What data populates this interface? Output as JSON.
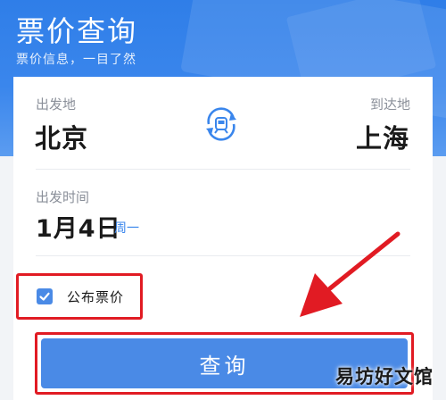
{
  "header": {
    "title": "票价查询",
    "subtitle": "票价信息，一目了然"
  },
  "route": {
    "from_label": "出发地",
    "from_city": "北京",
    "to_label": "到达地",
    "to_city": "上海",
    "swap_icon": "train-swap-icon"
  },
  "departure": {
    "label": "出发时间",
    "date": "1月4日",
    "weekday": "周一"
  },
  "options": {
    "public_fare_label": "公布票价",
    "public_fare_checked": true
  },
  "actions": {
    "query_label": "查询"
  },
  "watermark": "易坊好文馆",
  "colors": {
    "primary": "#4a8ae6",
    "header": "#3a86ec",
    "highlight": "#e11b23"
  }
}
